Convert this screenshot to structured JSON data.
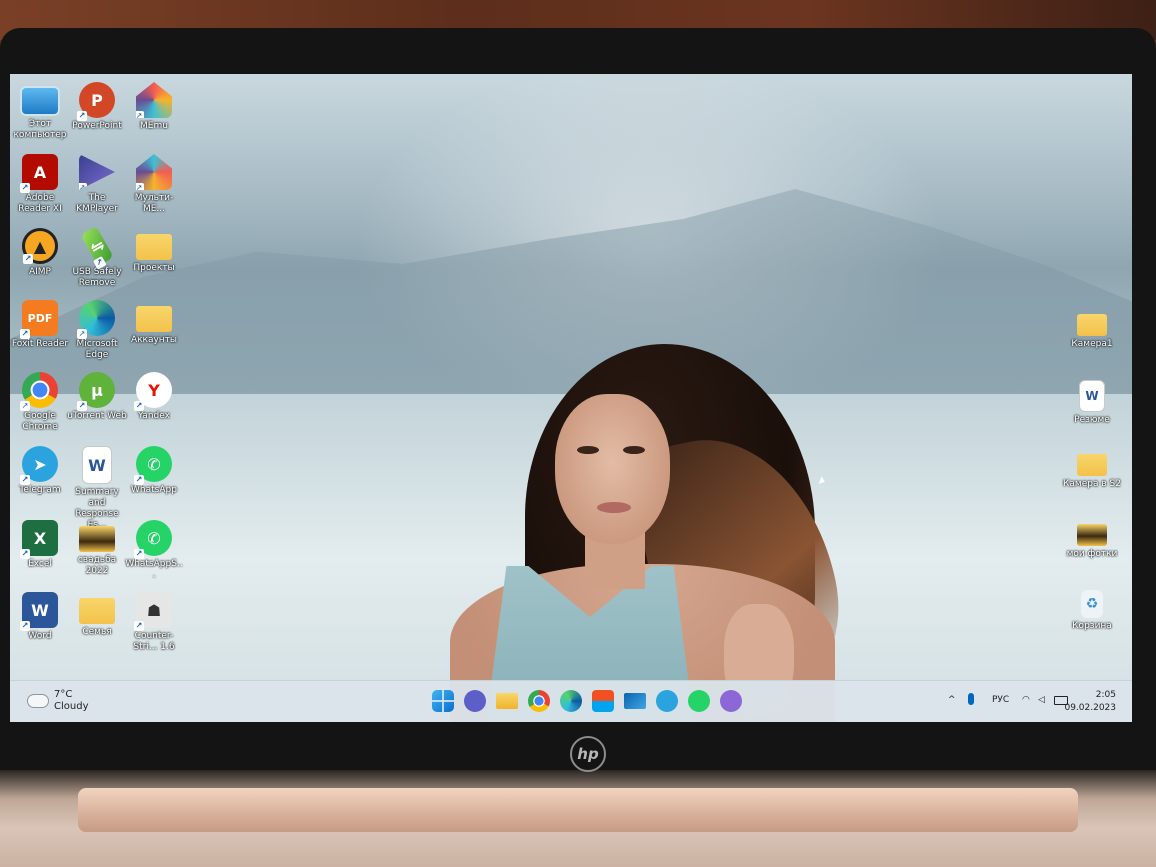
{
  "desktop": {
    "left_icons": [
      {
        "label": "Этот компьютер",
        "icon": "this-pc-icon"
      },
      {
        "label": "PowerPoint",
        "icon": "powerpoint-icon"
      },
      {
        "label": "MEmu",
        "icon": "memu-icon"
      },
      {
        "label": "Adobe Reader XI",
        "icon": "adobe-reader-icon"
      },
      {
        "label": "The KMPlayer",
        "icon": "kmplayer-icon"
      },
      {
        "label": "Мульти-МЕ...",
        "icon": "multi-memu-icon"
      },
      {
        "label": "AIMP",
        "icon": "aimp-icon"
      },
      {
        "label": "USB Safely Remove",
        "icon": "usb-safely-remove-icon"
      },
      {
        "label": "Проекты",
        "icon": "folder-icon"
      },
      {
        "label": "Foxit Reader",
        "icon": "foxit-reader-icon"
      },
      {
        "label": "Microsoft Edge",
        "icon": "edge-icon"
      },
      {
        "label": "Аккаунты",
        "icon": "folder-icon"
      },
      {
        "label": "Google Chrome",
        "icon": "chrome-icon"
      },
      {
        "label": "uTorrent Web",
        "icon": "utorrent-icon"
      },
      {
        "label": "Yandex",
        "icon": "yandex-icon"
      },
      {
        "label": "Telegram",
        "icon": "telegram-icon"
      },
      {
        "label": "Summary and Response Es...",
        "icon": "word-document-icon"
      },
      {
        "label": "WhatsApp",
        "icon": "whatsapp-icon"
      },
      {
        "label": "Excel",
        "icon": "excel-icon"
      },
      {
        "label": "свадьба 2022",
        "icon": "folder-icon"
      },
      {
        "label": "WhatsAppS...",
        "icon": "whatsapp-icon"
      },
      {
        "label": "Word",
        "icon": "word-icon"
      },
      {
        "label": "Семья",
        "icon": "folder-icon"
      },
      {
        "label": "Counter-Stri... 1.6",
        "icon": "counter-strike-icon"
      }
    ],
    "right_icons": [
      {
        "label": "Камера1",
        "icon": "folder-icon"
      },
      {
        "label": "Резюме",
        "icon": "word-document-icon"
      },
      {
        "label": "Камера в S2",
        "icon": "folder-icon"
      },
      {
        "label": "мои фотки",
        "icon": "folder-icon"
      },
      {
        "label": "Корзина",
        "icon": "recycle-bin-icon"
      }
    ]
  },
  "taskbar": {
    "weather": {
      "temp": "7°C",
      "condition": "Cloudy"
    },
    "apps": [
      "start-icon",
      "teams-chat-icon",
      "file-explorer-icon",
      "chrome-icon",
      "edge-icon",
      "store-icon",
      "mail-icon",
      "telegram-icon",
      "whatsapp-icon",
      "viber-icon"
    ],
    "tray": {
      "chevron": "^",
      "language": "РУС"
    },
    "clock": {
      "time": "2:05",
      "date": "09.02.2023"
    }
  },
  "laptop": {
    "brand": "hp"
  },
  "colors": {
    "taskbar": "#dae4ea",
    "folder": "#f3c24b",
    "accent": "#0067c0"
  }
}
